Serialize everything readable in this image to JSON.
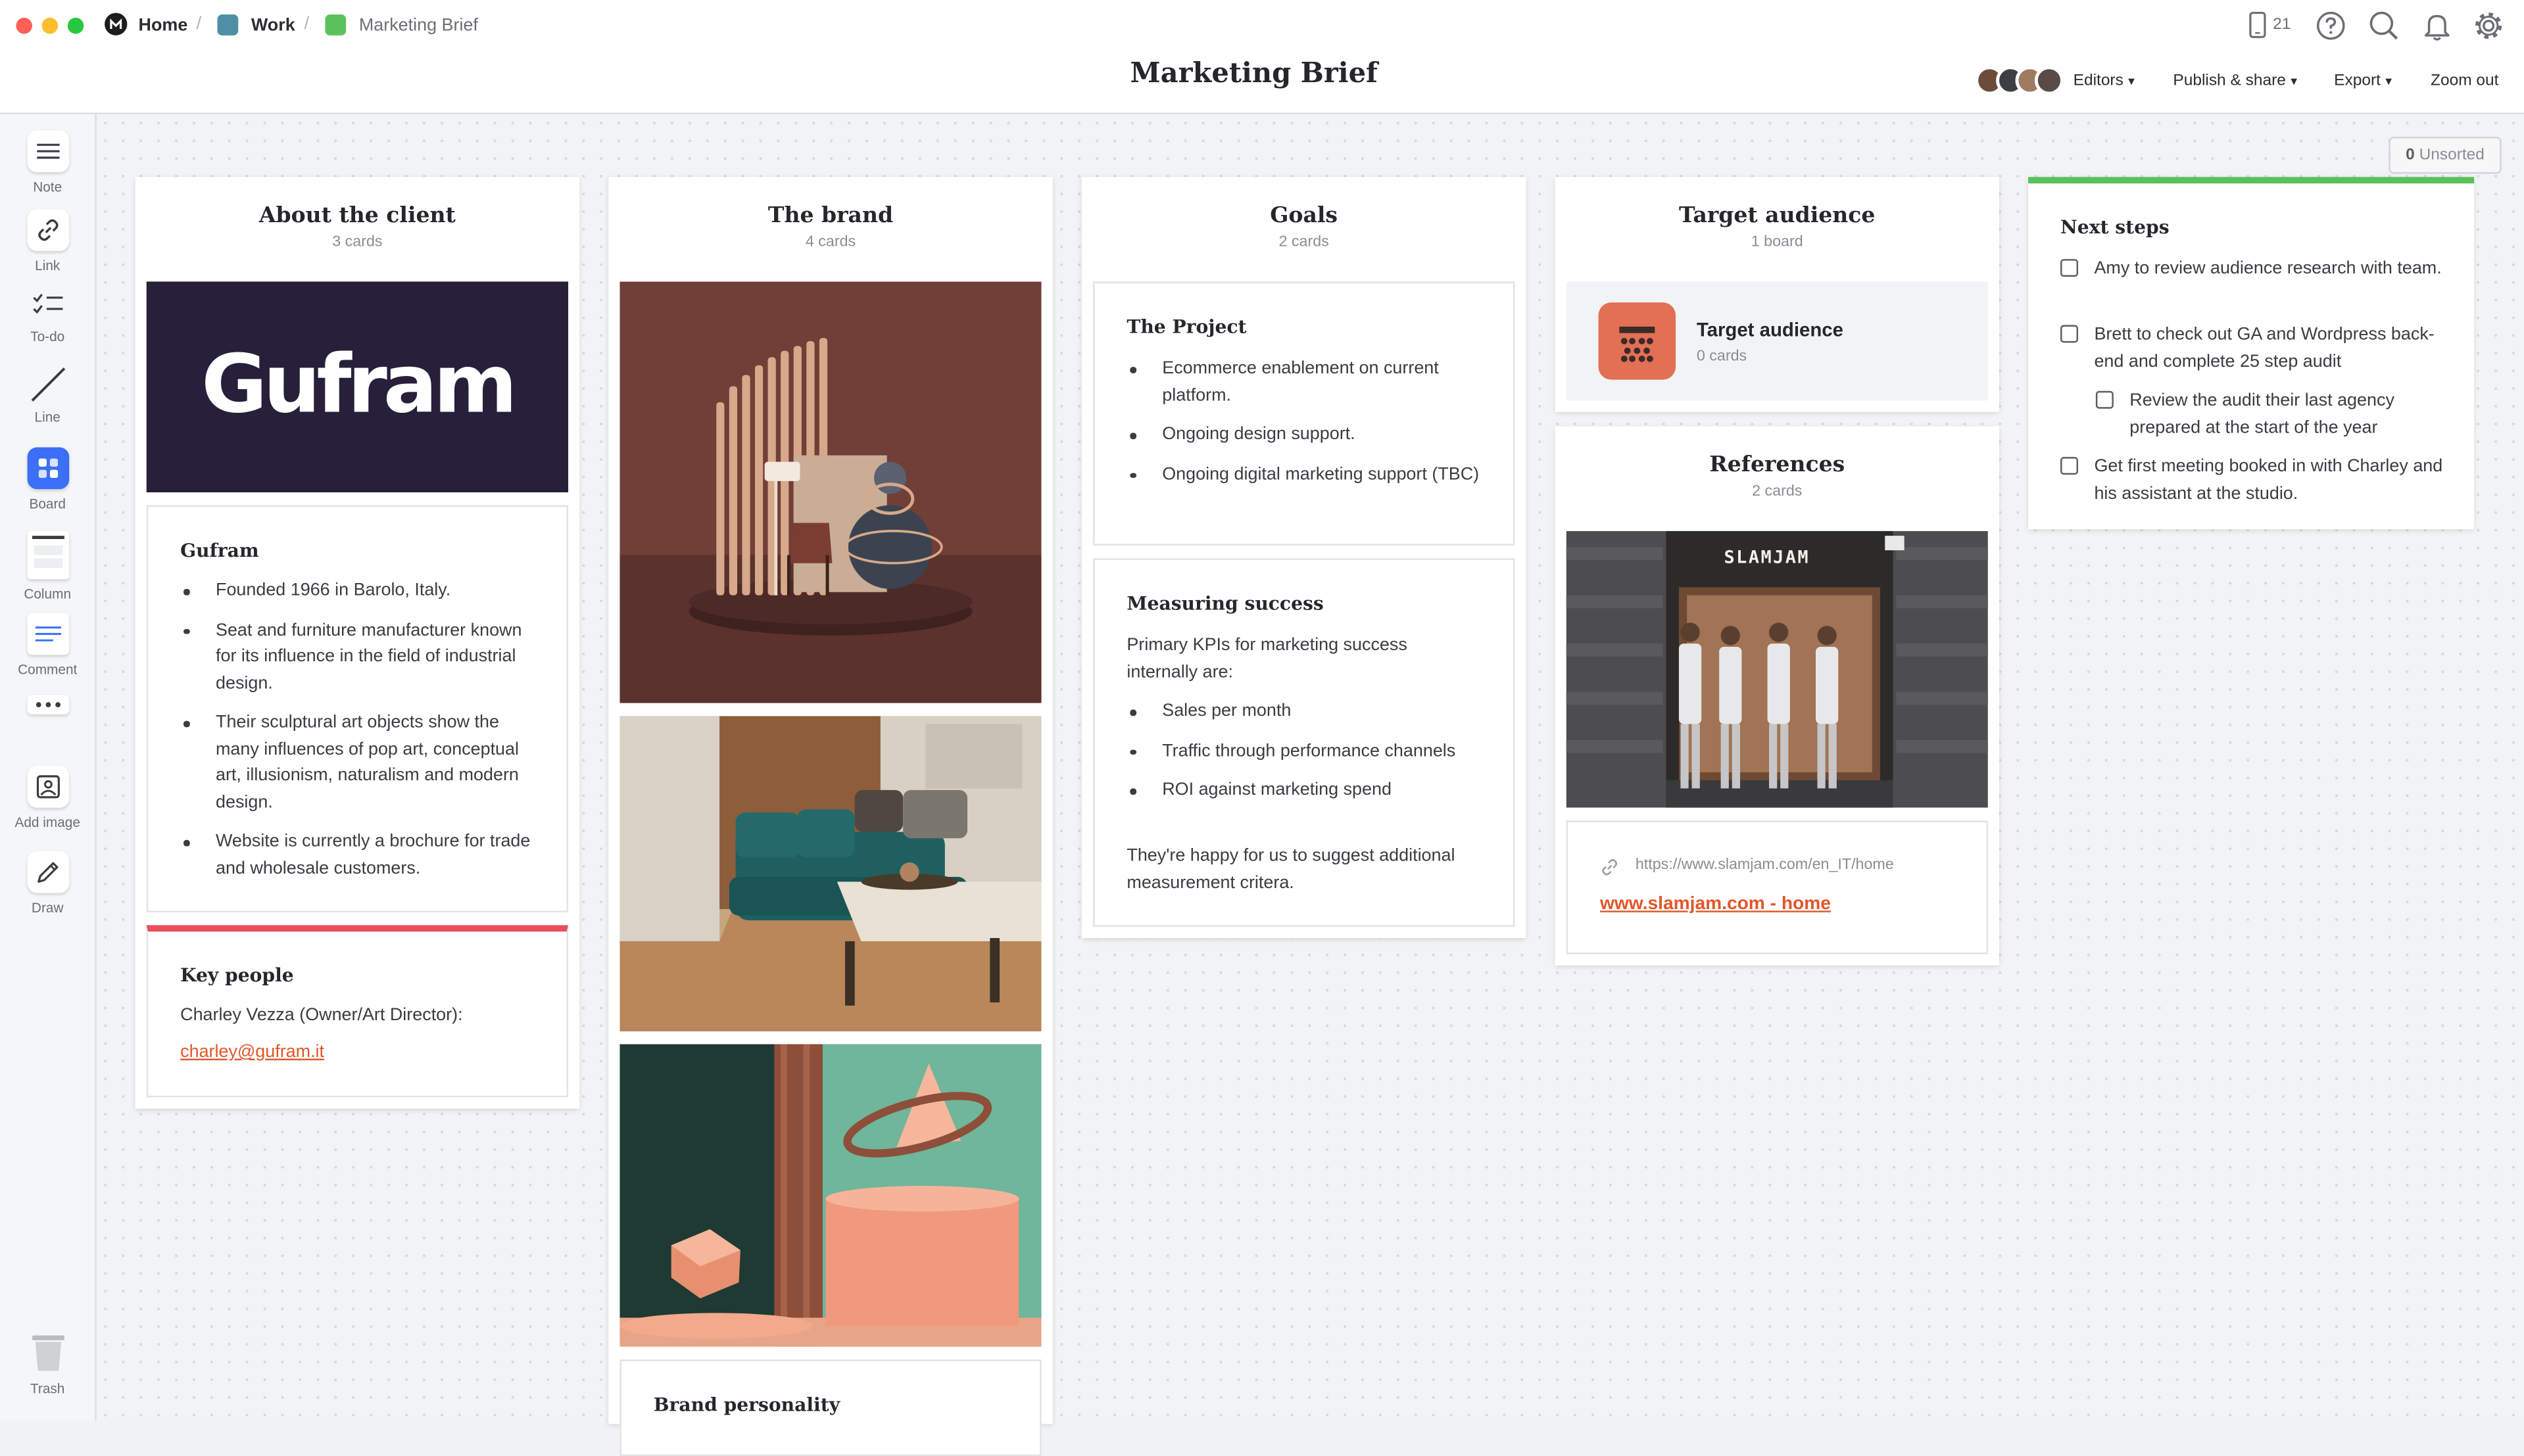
{
  "window": {
    "controls": [
      "close",
      "minimize",
      "maximize"
    ]
  },
  "breadcrumbs": [
    {
      "label": "Home",
      "icon": "milanote-logo-icon",
      "color": "#1d1d1f"
    },
    {
      "label": "Work",
      "icon": "board-icon",
      "color": "#4f8fa6"
    },
    {
      "label": "Marketing Brief",
      "icon": "board-icon",
      "color": "#5cc25b"
    }
  ],
  "title": "Marketing Brief",
  "header": {
    "device_count": "21",
    "editors_label": "Editors",
    "publish_label": "Publish & share",
    "export_label": "Export",
    "zoom_label": "Zoom out"
  },
  "toolbar": [
    {
      "label": "Note",
      "icon": "note-icon"
    },
    {
      "label": "Link",
      "icon": "link-icon"
    },
    {
      "label": "To-do",
      "icon": "todo-icon"
    },
    {
      "label": "Line",
      "icon": "line-icon"
    },
    {
      "label": "Board",
      "icon": "board-icon"
    },
    {
      "label": "Column",
      "icon": "column-icon"
    },
    {
      "label": "Comment",
      "icon": "comment-icon"
    },
    {
      "label": "",
      "icon": "more-icon"
    },
    {
      "label": "Add image",
      "icon": "add-image-icon"
    },
    {
      "label": "Draw",
      "icon": "pen-icon"
    }
  ],
  "trash_label": "Trash",
  "unsorted": {
    "count": "0",
    "label": "Unsorted"
  },
  "columns": {
    "client": {
      "title": "About the client",
      "subtitle": "3 cards",
      "logo_text": "Gufram",
      "gufram_card": {
        "heading": "Gufram",
        "bullets": [
          "Founded 1966 in Barolo, Italy.",
          "Seat and furniture manufacturer known for its influence in the field of industrial design.",
          "Their sculptural art objects show the many influences of pop art, conceptual art, illusionism, naturalism and modern design.",
          "Website is currently a brochure for trade and wholesale customers."
        ]
      },
      "key_people": {
        "heading": "Key people",
        "text": "Charley Vezza (Owner/Art Director):",
        "email": "charley@gufram.it",
        "accent": "#ea4e5a"
      }
    },
    "brand": {
      "title": "The brand",
      "subtitle": "4 cards",
      "personality_heading": "Brand personality"
    },
    "goals": {
      "title": "Goals",
      "subtitle": "2 cards",
      "project": {
        "heading": "The Project",
        "bullets": [
          "Ecommerce enablement on current platform.",
          "Ongoing design support.",
          "Ongoing digital marketing support (TBC)"
        ]
      },
      "success": {
        "heading": "Measuring success",
        "intro": "Primary KPIs for marketing success internally are:",
        "bullets": [
          "Sales per month",
          "Traffic through performance channels",
          "ROI against marketing spend"
        ],
        "outro": "They're happy for us to suggest additional measurement critera."
      }
    },
    "audience": {
      "title": "Target audience",
      "subtitle": "1 board",
      "board": {
        "title": "Target audience",
        "subtitle": "0 cards",
        "color": "#e36f55"
      }
    },
    "references": {
      "title": "References",
      "subtitle": "2 cards",
      "sign_text": "SLAMJAM",
      "url": "https://www.slamjam.com/en_IT/home",
      "link_text": "www.slamjam.com - home"
    },
    "next_steps": {
      "heading": "Next steps",
      "accent": "#57c15a",
      "items": [
        {
          "text": "Amy to review audience research with team.",
          "checked": false
        },
        {
          "text": "Brett to check out GA and Wordpress back-end and complete 25 step audit",
          "checked": false
        },
        {
          "text": "Review the audit their last agency prepared at the start of the year",
          "checked": false
        },
        {
          "text": "Get first meeting booked in with Charley and his assistant at the studio.",
          "checked": false
        }
      ]
    }
  }
}
